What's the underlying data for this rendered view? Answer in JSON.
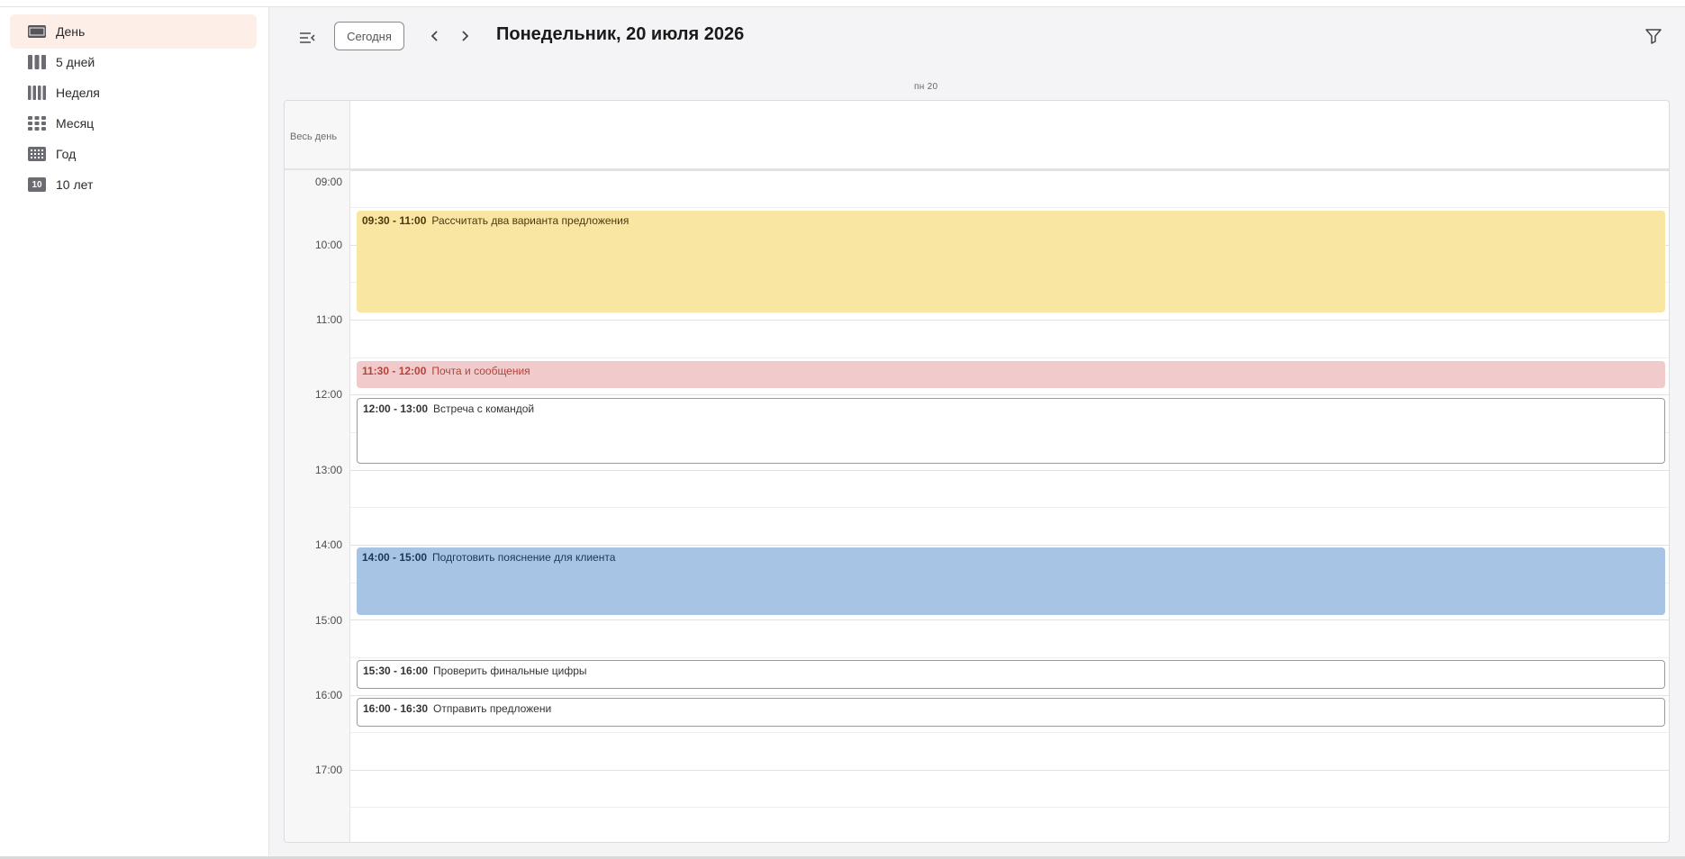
{
  "sidebar": {
    "items": [
      {
        "label": "День",
        "icon": "day-view-icon",
        "active": true
      },
      {
        "label": "5 дней",
        "icon": "five-days-view-icon",
        "active": false
      },
      {
        "label": "Неделя",
        "icon": "week-view-icon",
        "active": false
      },
      {
        "label": "Месяц",
        "icon": "month-view-icon",
        "active": false
      },
      {
        "label": "Год",
        "icon": "year-view-icon",
        "active": false
      },
      {
        "label": "10 лет",
        "icon": "decade-view-icon",
        "icon_text": "10",
        "active": false
      }
    ]
  },
  "toolbar": {
    "today_label": "Сегодня",
    "date_title": "Понедельник, 20 июля 2026"
  },
  "calendar": {
    "day_header": "пн 20",
    "allday_label": "Весь день",
    "hours": [
      "09:00",
      "10:00",
      "11:00",
      "12:00",
      "13:00",
      "14:00",
      "15:00",
      "16:00",
      "17:00"
    ],
    "events": [
      {
        "time": "09:30 - 11:00",
        "title": "Рассчитать два варианта предложения",
        "color": "#fae6a3"
      },
      {
        "time": "11:30 - 12:00",
        "title": "Почта и сообщения",
        "color": "#f1cbcb"
      },
      {
        "time": "12:00 - 13:00",
        "title": "Встреча с командой",
        "color": "#ffffff"
      },
      {
        "time": "14:00 - 15:00",
        "title": "Подготовить пояснение для клиента",
        "color": "#a8c4e5"
      },
      {
        "time": "15:30 - 16:00",
        "title": "Проверить финальные цифры",
        "color": "#ffffff"
      },
      {
        "time": "16:00 - 16:30",
        "title": "Отправить предложени",
        "color": "#ffffff"
      }
    ]
  },
  "colors": {
    "accent_active": "#fdefe8",
    "icon_gray": "#6b6b72"
  }
}
